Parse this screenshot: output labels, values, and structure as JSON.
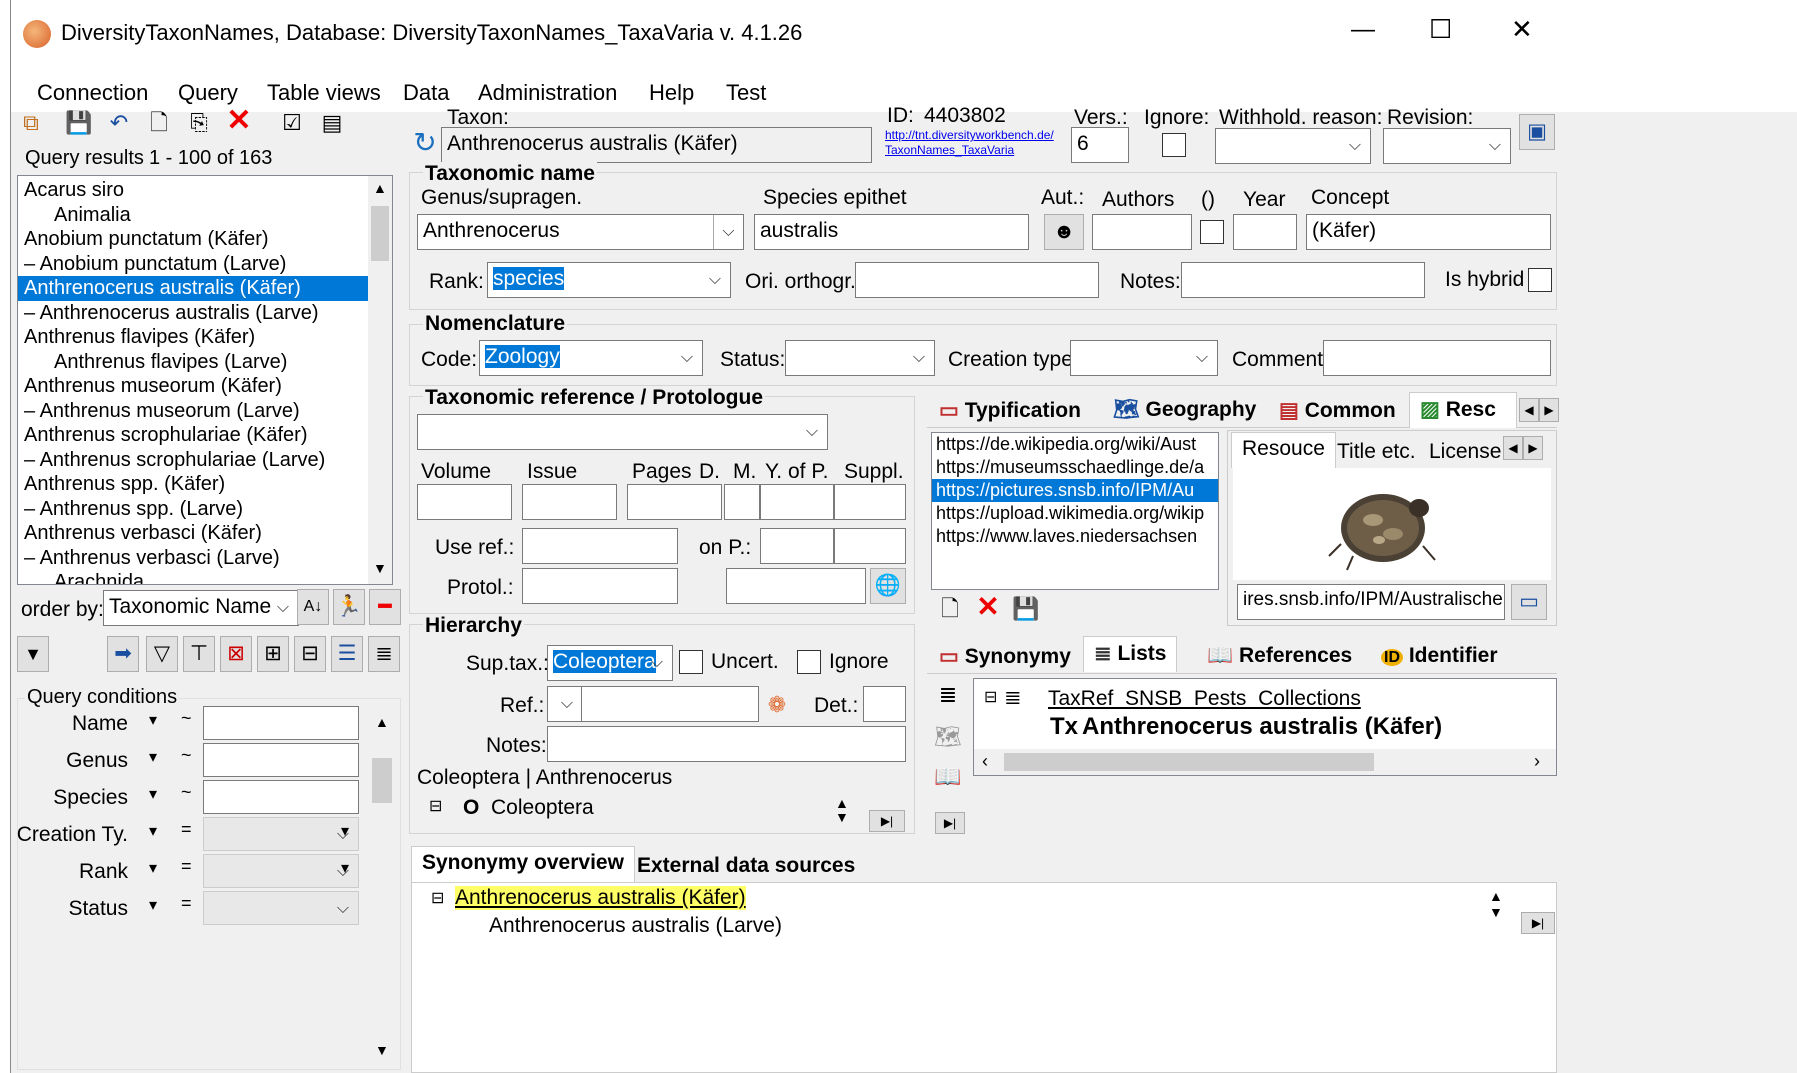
{
  "window": {
    "title": "DiversityTaxonNames,  Database: DiversityTaxonNames_TaxaVaria    v. 4.1.26",
    "minimize": "—",
    "maximize": "☐",
    "close": "✕"
  },
  "menu": [
    "Connection",
    "Query",
    "Table views",
    "Data",
    "Administration",
    "Help",
    "Test"
  ],
  "query": {
    "results_label": "Query results",
    "results_range": "1 - 100 of 163",
    "items": [
      {
        "text": "Acarus siro",
        "indent": 0
      },
      {
        "text": "Animalia",
        "indent": 2
      },
      {
        "text": "Anobium punctatum (Käfer)",
        "indent": 0
      },
      {
        "text": "–   Anobium punctatum (Larve)",
        "indent": 0
      },
      {
        "text": "Anthrenocerus australis (Käfer)",
        "indent": 0,
        "selected": true
      },
      {
        "text": "–   Anthrenocerus australis (Larve)",
        "indent": 0
      },
      {
        "text": "Anthrenus flavipes (Käfer)",
        "indent": 0
      },
      {
        "text": "Anthrenus flavipes (Larve)",
        "indent": 2
      },
      {
        "text": "Anthrenus museorum (Käfer)",
        "indent": 0
      },
      {
        "text": "–   Anthrenus museorum (Larve)",
        "indent": 0
      },
      {
        "text": "Anthrenus scrophulariae (Käfer)",
        "indent": 0
      },
      {
        "text": "–   Anthrenus scrophulariae (Larve)",
        "indent": 0
      },
      {
        "text": "Anthrenus spp. (Käfer)",
        "indent": 0
      },
      {
        "text": "–   Anthrenus spp. (Larve)",
        "indent": 0
      },
      {
        "text": "Anthrenus verbasci (Käfer)",
        "indent": 0
      },
      {
        "text": "–   Anthrenus verbasci (Larve)",
        "indent": 0
      },
      {
        "text": "Arachnida",
        "indent": 2
      }
    ],
    "order_by_label": "order by:",
    "order_by_value": "Taxonomic Name",
    "conditions_label": "Query conditions",
    "conditions": [
      {
        "label": "Name",
        "op": "~"
      },
      {
        "label": "Genus",
        "op": "~"
      },
      {
        "label": "Species",
        "op": "~"
      },
      {
        "label": "Creation Ty.",
        "op": "="
      },
      {
        "label": "Rank",
        "op": "="
      },
      {
        "label": "Status",
        "op": "="
      }
    ]
  },
  "header": {
    "taxon_label": "Taxon:",
    "taxon_value": "Anthrenocerus australis (Käfer)",
    "id_label": "ID:",
    "id_value": "4403802",
    "id_link": "http://tnt.diversityworkbench.de/TaxonNames_TaxaVaria",
    "vers_label": "Vers.:",
    "vers_value": "6",
    "ignore_label": "Ignore:",
    "withhold_label": "Withhold. reason:",
    "revision_label": "Revision:"
  },
  "taxonomic_name": {
    "section": "Taxonomic name",
    "genus_label": "Genus/supragen.",
    "genus_value": "Anthrenocerus",
    "species_label": "Species epithet",
    "species_value": "australis",
    "aut_label": "Aut.:",
    "authors_label": "Authors",
    "paren_label": "()",
    "year_label": "Year",
    "concept_label": "Concept",
    "concept_value": "(Käfer)",
    "rank_label": "Rank:",
    "rank_value": "species",
    "ori_label": "Ori. orthogr.:",
    "notes_label": "Notes:",
    "hybrid_label": "Is hybrid"
  },
  "nomenclature": {
    "section": "Nomenclature",
    "code_label": "Code:",
    "code_value": "Zoology",
    "status_label": "Status:",
    "creation_label": "Creation type:",
    "comment_label": "Comment:"
  },
  "reference": {
    "section": "Taxonomic reference / Protologue",
    "volume": "Volume",
    "issue": "Issue",
    "pages": "Pages",
    "d": "D.",
    "m": "M.",
    "yofp": "Y. of P.",
    "suppl": "Suppl.",
    "useref": "Use ref.:",
    "onp": "on P.:",
    "protol": "Protol.:"
  },
  "hierarchy": {
    "section": "Hierarchy",
    "suptax_label": "Sup.tax.:",
    "suptax_value": "Coleoptera",
    "uncert": "Uncert.",
    "ignore": "Ignore",
    "ref_label": "Ref.:",
    "det_label": "Det.:",
    "notes_label": "Notes:",
    "path": "Coleoptera | Anthrenocerus",
    "tree_rank": "O",
    "tree_item": "Coleoptera"
  },
  "resource_tabs": [
    "Typification",
    "Geography",
    "Common",
    "Resc"
  ],
  "resources": {
    "urls": [
      "https://de.wikipedia.org/wiki/Aust",
      "https://museumsschaedlinge.de/a",
      "https://pictures.snsb.info/IPM/Au",
      "https://upload.wikimedia.org/wikip",
      "https://www.laves.niedersachsen"
    ],
    "selected_index": 2,
    "subtabs": [
      "Resouce",
      "Title etc.",
      "License"
    ],
    "url_field": "ires.snsb.info/IPM/Australischer"
  },
  "lists_tabs": [
    "Synonymy",
    "Lists",
    "References",
    "Identifier"
  ],
  "lists": {
    "list_name": "TaxRef_SNSB_Pests_Collections",
    "entry_prefix": "Tx",
    "entry": "Anthrenocerus australis (Käfer)"
  },
  "bottom_tabs": [
    "Synonymy overview",
    "External data sources"
  ],
  "synonymy": {
    "accepted": "Anthrenocerus australis (Käfer)",
    "synonym": "Anthrenocerus australis (Larve)"
  },
  "colors": {
    "selection": "#0078d7",
    "highlight": "#ffff66",
    "link": "#0000ee"
  }
}
